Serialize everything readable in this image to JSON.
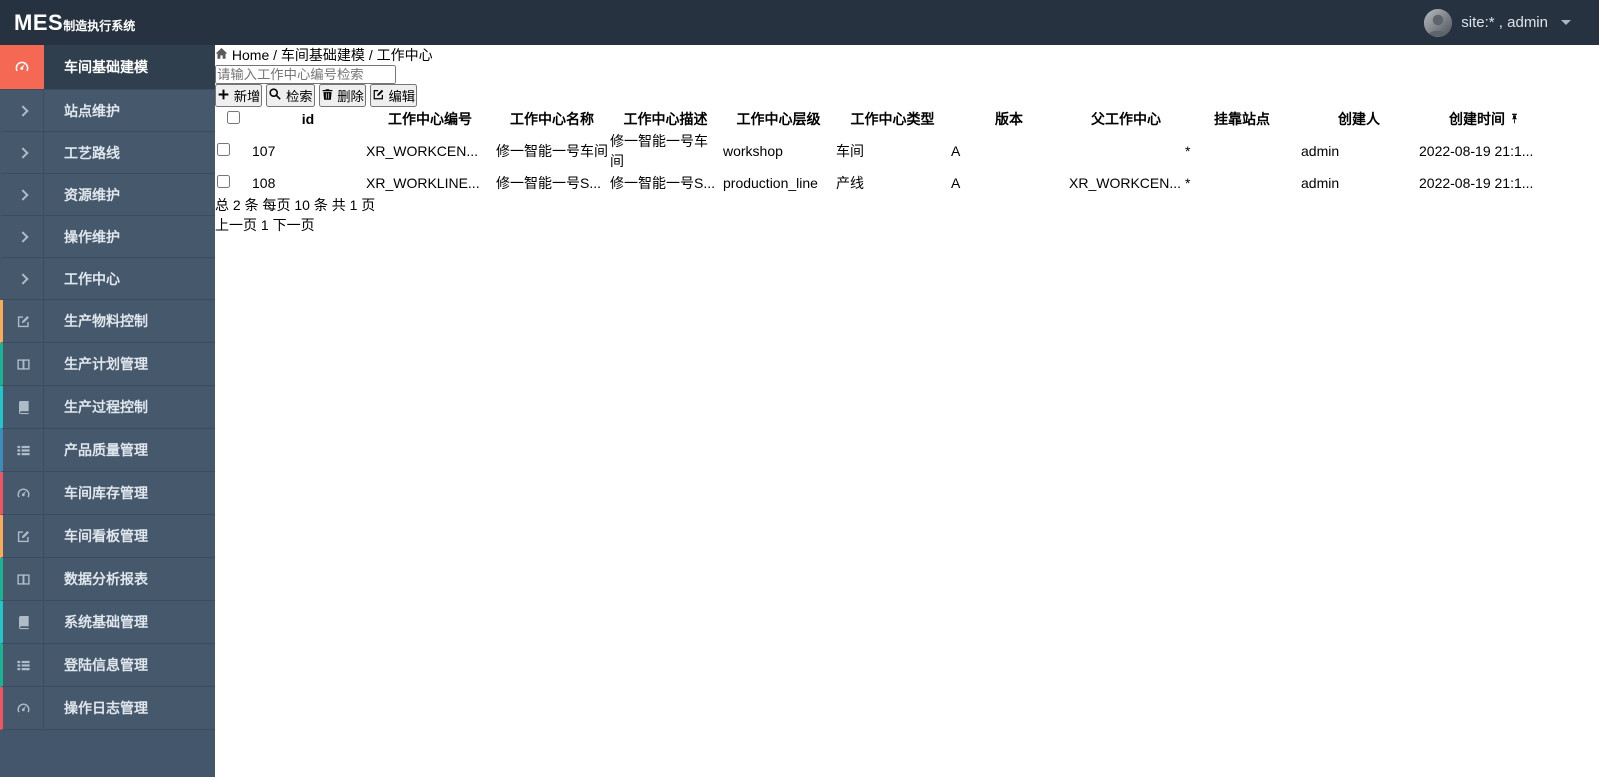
{
  "navbar": {
    "brand_bold": "MES",
    "brand_rest": "制造执行系统",
    "user_label": "site:* , admin"
  },
  "breadcrumb": {
    "home": "Home",
    "level2": "车间基础建模",
    "current": "工作中心",
    "separator": "/"
  },
  "sidebar": {
    "parent_active": {
      "label": "车间基础建模",
      "icon": "gauge-icon",
      "accent": "#F56954"
    },
    "sub_items": [
      {
        "label": "站点维护"
      },
      {
        "label": "工艺路线"
      },
      {
        "label": "资源维护"
      },
      {
        "label": "操作维护"
      },
      {
        "label": "工作中心"
      }
    ],
    "items": [
      {
        "label": "生产物料控制",
        "icon": "pencil-square-icon",
        "accent": "#F8AC59"
      },
      {
        "label": "生产计划管理",
        "icon": "columns-icon",
        "accent": "#1AB394"
      },
      {
        "label": "生产过程控制",
        "icon": "book-icon",
        "accent": "#23C6C8"
      },
      {
        "label": "产品质量管理",
        "icon": "th-list-icon",
        "accent": "#3C8DBC"
      },
      {
        "label": "车间库存管理",
        "icon": "gauge-icon",
        "accent": "#ED5565"
      },
      {
        "label": "车间看板管理",
        "icon": "pencil-square-icon",
        "accent": "#F8AC59"
      },
      {
        "label": "数据分析报表",
        "icon": "columns-icon",
        "accent": "#1AB394"
      },
      {
        "label": "系统基础管理",
        "icon": "book-icon",
        "accent": "#23C6C8"
      },
      {
        "label": "登陆信息管理",
        "icon": "th-list-icon",
        "accent": "#1AB394"
      },
      {
        "label": "操作日志管理",
        "icon": "gauge-icon",
        "accent": "#ED5565"
      }
    ]
  },
  "toolbar": {
    "search_placeholder": "请输入工作中心编号检索",
    "add_label": "新增",
    "search_label": "检索",
    "delete_label": "删除",
    "edit_label": "编辑"
  },
  "table": {
    "headers": [
      "id",
      "工作中心编号",
      "工作中心名称",
      "工作中心描述",
      "工作中心层级",
      "工作中心类型",
      "版本",
      "父工作中心",
      "挂靠站点",
      "创建人",
      "创建时间"
    ],
    "rows": [
      {
        "cells": [
          "107",
          "XR_WORKCEN...",
          "修一智能一号车间",
          "修一智能一号车间",
          "workshop",
          "车间",
          "A",
          "",
          "*",
          "admin",
          "2022-08-19 21:1..."
        ]
      },
      {
        "cells": [
          "108",
          "XR_WORKLINE...",
          "修一智能一号S...",
          "修一智能一号S...",
          "production_line",
          "产线",
          "A",
          "XR_WORKCEN...",
          "*",
          "admin",
          "2022-08-19 21:1..."
        ]
      }
    ]
  },
  "pagination": {
    "summary_total": "总 2 条",
    "summary_per_page": "每页 10 条",
    "summary_pages": "共 1 页",
    "prev_label": "上一页",
    "page_label": "1",
    "next_label": "下一页"
  },
  "colors": {
    "navbar_bg": "#273240",
    "sidebar_bg": "#44566B",
    "active_menu_accent": "#F56954",
    "primary": "#428BCA",
    "danger": "#D9534F",
    "info": "#5BC0DE",
    "link": "#428BCA"
  }
}
